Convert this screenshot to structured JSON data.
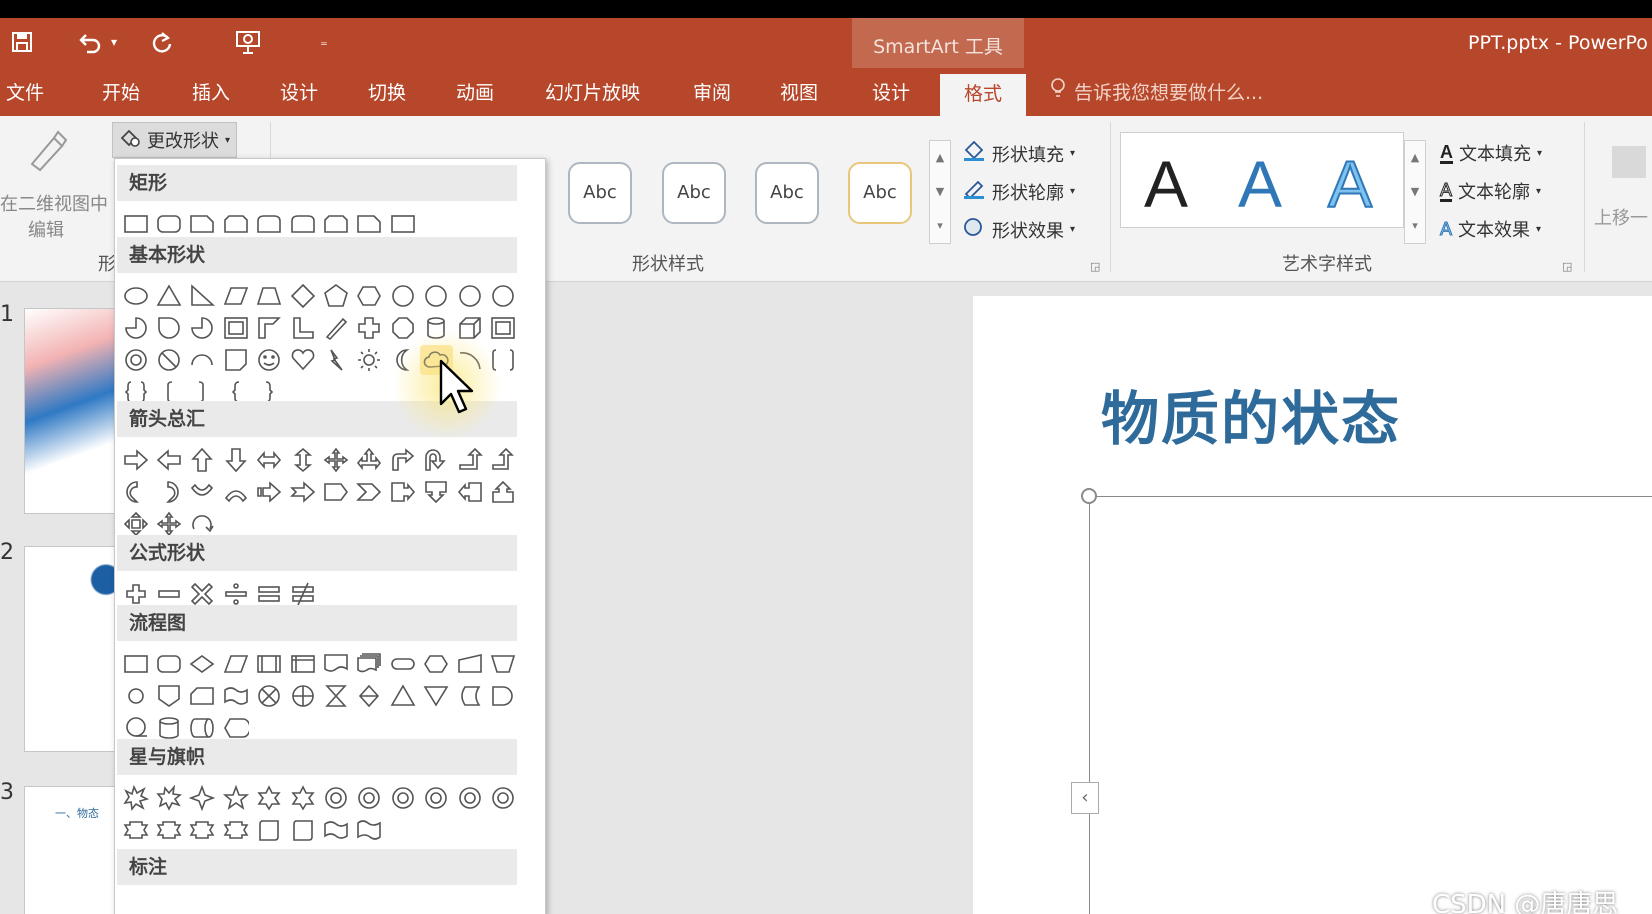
{
  "titlebar": {
    "contextual_title": "SmartArt 工具",
    "doc_title": "PPT.pptx - PowerPo",
    "qat": {
      "save": "save-icon",
      "undo": "undo-icon",
      "redo": "redo-icon",
      "present": "present-icon",
      "more": "more-icon"
    }
  },
  "tabs": {
    "file": "文件",
    "home": "开始",
    "insert": "插入",
    "design": "设计",
    "transitions": "切换",
    "animations": "动画",
    "slideshow": "幻灯片放映",
    "review": "审阅",
    "view": "视图",
    "sa_design": "设计",
    "sa_format": "格式",
    "tell_me": "告诉我您想要做什么..."
  },
  "ribbon": {
    "edit_2d_line1": "在二维视图中",
    "edit_2d_line2": "编辑",
    "change_shape": "更改形状",
    "shapes_group_partial": "形",
    "shape_style_items": [
      "Abc",
      "Abc",
      "Abc",
      "Abc"
    ],
    "shape_fill": "形状填充",
    "shape_outline": "形状轮廓",
    "shape_effects": "形状效果",
    "shape_styles_label": "形状样式",
    "wordart_letters": [
      "A",
      "A",
      "A"
    ],
    "text_fill": "文本填充",
    "text_outline": "文本轮廓",
    "text_effects": "文本效果",
    "wordart_styles_label": "艺术字样式",
    "move_up": "上移一"
  },
  "shape_panel": {
    "categories": [
      "矩形",
      "基本形状",
      "箭头总汇",
      "公式形状",
      "流程图",
      "星与旗帜",
      "标注"
    ],
    "hovered_shape": "cloud"
  },
  "slides": {
    "numbers": [
      "1",
      "2",
      "3"
    ],
    "thumb3_text": "一、物态"
  },
  "slide": {
    "title": "物质的状态"
  },
  "watermark": "CSDN @唐唐思"
}
